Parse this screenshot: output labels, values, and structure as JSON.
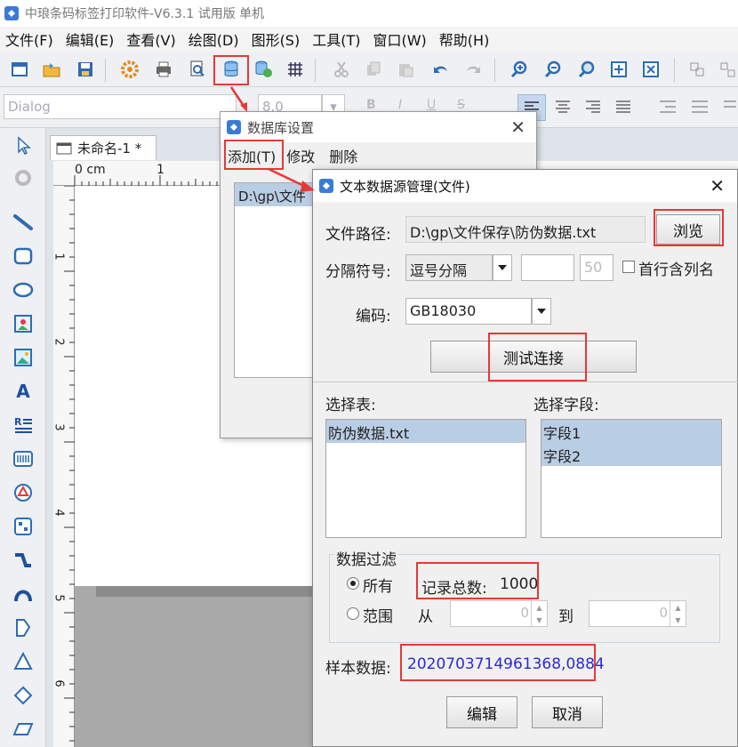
{
  "window": {
    "title": "中琅条码标签打印软件-V6.3.1 试用版 单机"
  },
  "menu": [
    "文件(F)",
    "编辑(E)",
    "查看(V)",
    "绘图(D)",
    "图形(S)",
    "工具(T)",
    "窗口(W)",
    "帮助(H)"
  ],
  "toolbar2": {
    "font": "Dialog",
    "size": "8.0"
  },
  "document": {
    "tab_label": "未命名-1 *",
    "ruler_unit": "0 cm",
    "ruler_ticks": [
      "1",
      "2",
      "3",
      "4",
      "5",
      "6"
    ]
  },
  "db_dialog": {
    "title": "数据库设置",
    "menu": {
      "add": "添加(T)",
      "edit": "修改",
      "delete": "删除"
    },
    "list_item": "D:\\gp\\文件"
  },
  "text_dialog": {
    "title": "文本数据源管理(文件)",
    "path_label": "文件路径:",
    "path_value": "D:\\gp\\文件保存\\防伪数据.txt",
    "browse": "浏览",
    "separator_label": "分隔符号:",
    "separator_value": "逗号分隔",
    "separator_count": "50",
    "first_row_header": "首行含列名",
    "encoding_label": "编码:",
    "encoding_value": "GB18030",
    "test_connection": "测试连接",
    "select_table_label": "选择表:",
    "tables": [
      "防伪数据.txt"
    ],
    "select_field_label": "选择字段:",
    "fields": [
      "字段1",
      "字段2"
    ],
    "filter_label": "数据过滤",
    "filter_all": "所有",
    "record_count_label": "记录总数:",
    "record_count": "1000",
    "filter_range": "范围",
    "from_label": "从",
    "to_label": "到",
    "range_from": "0",
    "range_to": "0",
    "sample_label": "样本数据:",
    "sample_value": "202070371496136­8,0884",
    "edit": "编辑",
    "cancel": "取消"
  },
  "colors": {
    "highlight": "#e53935",
    "sample_text": "#2a2ad6",
    "selection": "#b9cde4"
  }
}
